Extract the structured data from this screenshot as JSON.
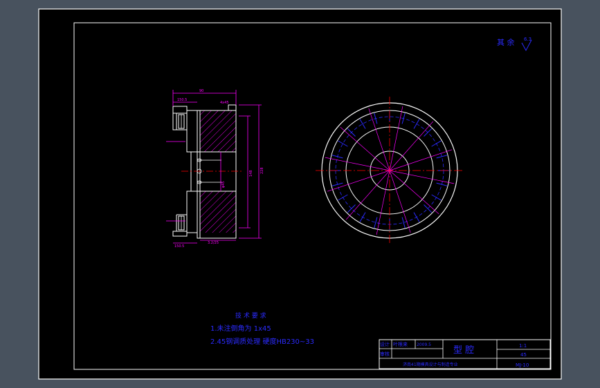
{
  "surface_note": {
    "prefix": "其 余",
    "symbol_value": "6.3"
  },
  "tech_requirements": {
    "title": "技 术 要 求",
    "line1": "1.未注倒角为 1x45",
    "line2": "2.45钢调质处理 硬度HB230~33"
  },
  "title_block": {
    "part_name": "型 腔",
    "scale": "1:1",
    "material": "45",
    "drawing_no": "MJ-10",
    "row_labels": [
      "设计",
      "审核"
    ],
    "designer_cell": "叶根来",
    "date_cell": "2009.5",
    "school": "济南41期模具设计与制造专业"
  },
  "dimensions": {
    "top_width": "90",
    "top_left": "150.5",
    "top_right": "4x45",
    "right_outer": "228",
    "right_inner": "148",
    "bore": "φ45",
    "bottom_left": "150.5",
    "bottom_mid": "3.2/25"
  },
  "colors": {
    "background": "#48525e",
    "paper": "#000000",
    "frame": "#ffffff",
    "dimension": "#ff00ff",
    "text": "#2b2bff",
    "hatch": "#ff00ff",
    "red_line": "#ff0000"
  }
}
